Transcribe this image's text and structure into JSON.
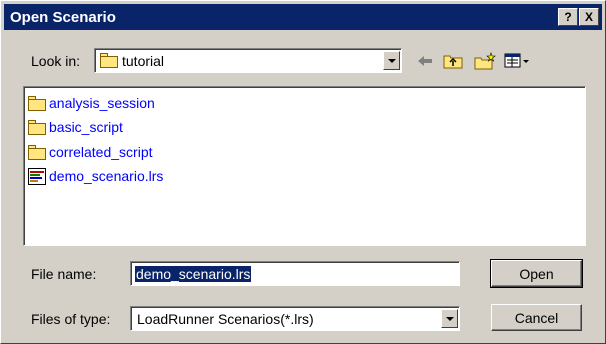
{
  "window": {
    "title": "Open Scenario",
    "help_button": "?",
    "close_button": "X"
  },
  "lookin": {
    "label": "Look in:",
    "value": "tutorial"
  },
  "toolbar": {
    "icons": [
      "back-arrow-icon",
      "up-one-level-icon",
      "new-folder-icon",
      "view-menu-icon"
    ]
  },
  "files": [
    {
      "name": "analysis_session",
      "type": "folder"
    },
    {
      "name": "basic_script",
      "type": "folder"
    },
    {
      "name": "correlated_script",
      "type": "folder"
    },
    {
      "name": "demo_scenario.lrs",
      "type": "scenario"
    }
  ],
  "filename": {
    "label": "File name:",
    "value": "demo_scenario.lrs"
  },
  "filetype": {
    "label": "Files of type:",
    "value": "LoadRunner Scenarios(*.lrs)"
  },
  "buttons": {
    "open": "Open",
    "cancel": "Cancel"
  },
  "colors": {
    "titlebar": "#0a246a",
    "file_link": "#0000ff",
    "dialog_bg": "#d4d0c8"
  }
}
